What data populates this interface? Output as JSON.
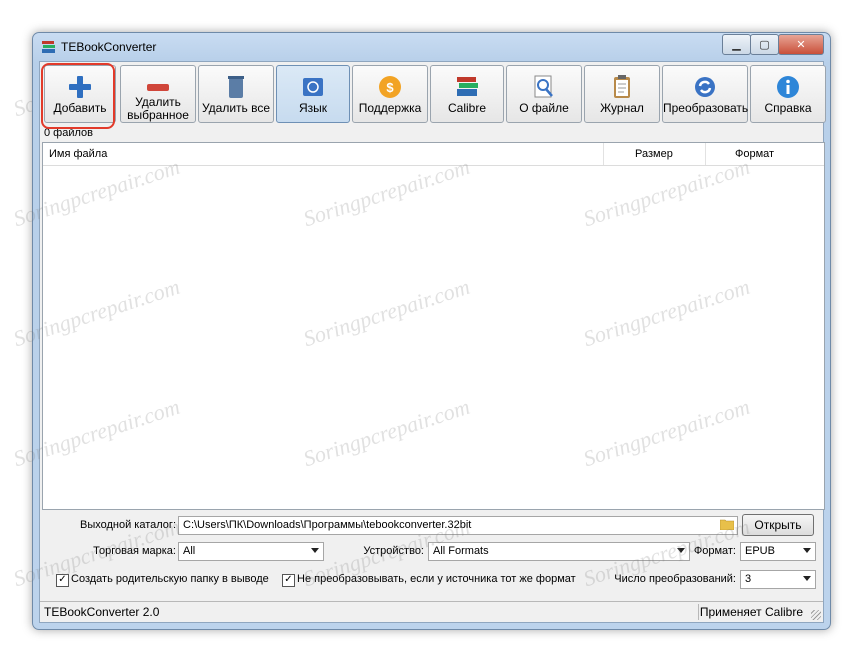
{
  "window": {
    "title": "TEBookConverter",
    "controls": [
      "minimize",
      "maximize",
      "close"
    ]
  },
  "toolbar": {
    "buttons": [
      {
        "label": "Добавить",
        "icon": "add-plus-icon",
        "highlighted": true
      },
      {
        "label": "Удалить выбранное",
        "icon": "remove-minus-icon"
      },
      {
        "label": "Удалить все",
        "icon": "trash-icon"
      },
      {
        "label": "Язык",
        "icon": "globe-flag-icon",
        "pressed": true
      },
      {
        "label": "Поддержка",
        "icon": "coin-support-icon"
      },
      {
        "label": "Calibre",
        "icon": "books-icon"
      },
      {
        "label": "О файле",
        "icon": "magnifier-file-icon"
      },
      {
        "label": "Журнал",
        "icon": "clipboard-log-icon"
      },
      {
        "label": "Преобразовать",
        "icon": "convert-arrows-icon"
      },
      {
        "label": "Справка",
        "icon": "info-icon"
      }
    ]
  },
  "file_count": "0 файлов",
  "file_list": {
    "columns": [
      "Имя файла",
      "Размер",
      "Формат"
    ],
    "rows": []
  },
  "output": {
    "label": "Выходной каталог:",
    "value": "C:\\Users\\ПК\\Downloads\\Программы\\tebookconverter.32bit",
    "open_label": "Открыть"
  },
  "brand": {
    "label": "Торговая марка:",
    "value": "All"
  },
  "device": {
    "label": "Устройство:",
    "value": "All Formats"
  },
  "format": {
    "label": "Формат:",
    "value": "EPUB"
  },
  "options": {
    "create_parent_folder": {
      "label": "Создать родительскую папку в выводе",
      "checked": true
    },
    "skip_same_format": {
      "label": "Не преобразовывать, если у источника тот же формат",
      "checked": true
    }
  },
  "conversions": {
    "label": "Число преобразований:",
    "value": "3"
  },
  "status": {
    "left": "TEBookConverter 2.0",
    "right": "Применяет Calibre"
  },
  "watermark": "Soringpcrepair.com",
  "colors": {
    "highlight": "#e23a2a",
    "titlebar": "#c9dcf2",
    "close_button": "#c9503a"
  }
}
